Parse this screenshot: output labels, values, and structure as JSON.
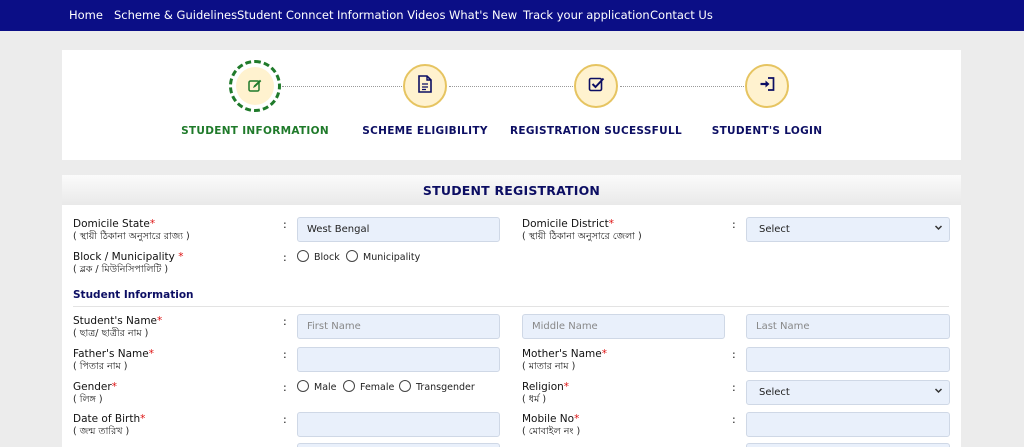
{
  "nav": [
    "Home",
    "Scheme & Guidelines",
    "Student Conncet",
    "Information Videos",
    "What's New",
    "Track your application",
    "Contact Us"
  ],
  "steps": [
    {
      "label": "STUDENT INFORMATION",
      "icon": "edit-icon",
      "active": true
    },
    {
      "label": "SCHEME ELIGIBILITY",
      "icon": "document-icon",
      "active": false
    },
    {
      "label": "REGISTRATION SUCESSFULL",
      "icon": "checkbox-icon",
      "active": false
    },
    {
      "label": "STUDENT'S LOGIN",
      "icon": "login-icon",
      "active": false
    }
  ],
  "form": {
    "title": "STUDENT REGISTRATION",
    "domicile_state": {
      "label": "Domicile State",
      "sub": "( স্থায়ী ঠিকানা অনুসারে রাজ্য )",
      "value": "West Bengal"
    },
    "domicile_district": {
      "label": "Domicile District",
      "sub": "( স্থায়ী ঠিকানা অনুসারে জেলা )",
      "value": "Select"
    },
    "block": {
      "label": "Block / Municipality",
      "sub": "( ব্লক / মিউনিসিপালিটি )",
      "options": [
        "Block",
        "Municipality"
      ]
    },
    "section_title": "Student Information",
    "student_name": {
      "label": "Student's Name",
      "sub": "( ছাত্র/ ছাত্রীর নাম )",
      "first_placeholder": "First Name",
      "middle_placeholder": "Middle Name",
      "last_placeholder": "Last Name"
    },
    "father_name": {
      "label": "Father's Name",
      "sub": "( পিতার নাম )"
    },
    "mother_name": {
      "label": "Mother's Name",
      "sub": "( মাতার নাম )"
    },
    "gender": {
      "label": "Gender",
      "sub": "( লিঙ্গ )",
      "options": [
        "Male",
        "Female",
        "Transgender"
      ]
    },
    "religion": {
      "label": "Religion",
      "sub": "( ধর্ম )",
      "value": "Select"
    },
    "dob": {
      "label": "Date of Birth",
      "sub": "( জন্ম তারিখ )"
    },
    "mobile": {
      "label": "Mobile No",
      "sub": "( মোবাইল নং )"
    },
    "required_mark": "*",
    "colon": ":"
  },
  "colors": {
    "nav_bg": "#0b0e86",
    "active_step": "#1f7a2a",
    "step_label": "#0c0e63",
    "step_circle": "#fff2cf",
    "required": "#d11"
  }
}
